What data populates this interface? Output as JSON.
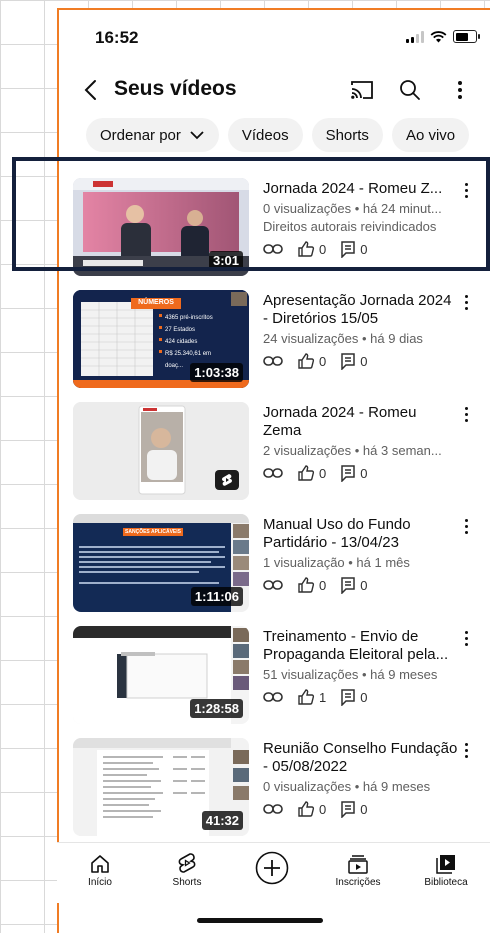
{
  "status": {
    "time": "16:52"
  },
  "header": {
    "title": "Seus vídeos",
    "icons": [
      "back-arrow-icon",
      "cast-icon",
      "search-icon",
      "more-vertical-icon"
    ]
  },
  "chips": [
    {
      "label": "Ordenar por"
    },
    {
      "label": "Vídeos"
    },
    {
      "label": "Shorts"
    },
    {
      "label": "Ao vivo"
    }
  ],
  "videos": [
    {
      "title": "Jornada 2024 - Romeu Z...",
      "meta": "0 visualizações • há 24 minut...",
      "rights": "Direitos autorais reivindicados",
      "likes": "0",
      "comments": "0",
      "duration": "3:01",
      "thumb": "studio-panel"
    },
    {
      "title": "Apresentação Jornada 2024 - Diretórios 15/05",
      "meta": "24 visualizações • há 9 dias",
      "likes": "0",
      "comments": "0",
      "duration": "1:03:38",
      "thumb": "slide-numeros",
      "slide": {
        "heading": "NÚMEROS",
        "bullets": [
          "4365 pré-inscritos",
          "27 Estados",
          "424 cidades",
          "R$ 25.340,61 em",
          "doaç..."
        ]
      }
    },
    {
      "title": "Jornada 2024 - Romeu Zema",
      "meta": "2 visualizações • há 3 seman...",
      "likes": "0",
      "comments": "0",
      "thumb": "short-vertical",
      "badge": "shorts-icon"
    },
    {
      "title": "Manual Uso do Fundo Partidário - 13/04/23",
      "meta": "1 visualização • há 1 mês",
      "likes": "0",
      "comments": "0",
      "duration": "1:11:06",
      "thumb": "slide-sancoes",
      "slide": {
        "heading": "SANÇÕES APLICÁVEIS"
      }
    },
    {
      "title": "Treinamento - Envio de Propaganda Eleitoral pela...",
      "meta": "51 visualizações • há 9 meses",
      "likes": "1",
      "comments": "0",
      "duration": "1:28:58",
      "thumb": "screen-share"
    },
    {
      "title": "Reunião Conselho Fundação - 05/08/2022",
      "meta": "0 visualizações • há 9 meses",
      "likes": "0",
      "comments": "0",
      "duration": "41:32",
      "thumb": "spreadsheet"
    }
  ],
  "bottom_nav": [
    {
      "label": "Início",
      "icon": "home-icon"
    },
    {
      "label": "Shorts",
      "icon": "shorts-icon"
    },
    {
      "label": "",
      "icon": "create-plus-icon"
    },
    {
      "label": "Inscrições",
      "icon": "subscriptions-icon"
    },
    {
      "label": "Biblioteca",
      "icon": "library-icon"
    }
  ],
  "colors": {
    "accent_border": "#f07c24",
    "highlight_box": "#14203c",
    "text_secondary": "#606060"
  }
}
